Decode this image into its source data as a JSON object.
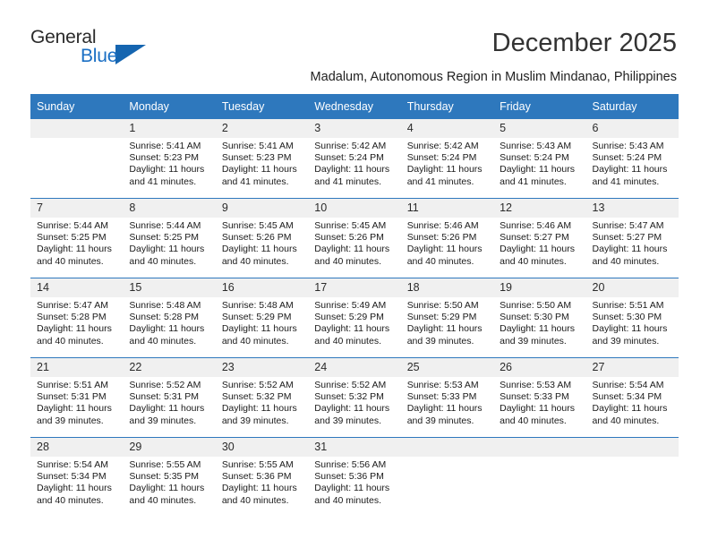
{
  "brand": {
    "name_primary": "General",
    "name_secondary": "Blue",
    "accent_color": "#1565b0",
    "header_color": "#2e78bd"
  },
  "header": {
    "month_title": "December 2025",
    "location": "Madalum, Autonomous Region in Muslim Mindanao, Philippines"
  },
  "weekdays": [
    "Sunday",
    "Monday",
    "Tuesday",
    "Wednesday",
    "Thursday",
    "Friday",
    "Saturday"
  ],
  "weeks": [
    [
      {
        "day": "",
        "empty": true,
        "sunrise": "",
        "sunset": "",
        "daylight_line1": "",
        "daylight_line2": ""
      },
      {
        "day": "1",
        "sunrise": "Sunrise: 5:41 AM",
        "sunset": "Sunset: 5:23 PM",
        "daylight_line1": "Daylight: 11 hours",
        "daylight_line2": "and 41 minutes."
      },
      {
        "day": "2",
        "sunrise": "Sunrise: 5:41 AM",
        "sunset": "Sunset: 5:23 PM",
        "daylight_line1": "Daylight: 11 hours",
        "daylight_line2": "and 41 minutes."
      },
      {
        "day": "3",
        "sunrise": "Sunrise: 5:42 AM",
        "sunset": "Sunset: 5:24 PM",
        "daylight_line1": "Daylight: 11 hours",
        "daylight_line2": "and 41 minutes."
      },
      {
        "day": "4",
        "sunrise": "Sunrise: 5:42 AM",
        "sunset": "Sunset: 5:24 PM",
        "daylight_line1": "Daylight: 11 hours",
        "daylight_line2": "and 41 minutes."
      },
      {
        "day": "5",
        "sunrise": "Sunrise: 5:43 AM",
        "sunset": "Sunset: 5:24 PM",
        "daylight_line1": "Daylight: 11 hours",
        "daylight_line2": "and 41 minutes."
      },
      {
        "day": "6",
        "sunrise": "Sunrise: 5:43 AM",
        "sunset": "Sunset: 5:24 PM",
        "daylight_line1": "Daylight: 11 hours",
        "daylight_line2": "and 41 minutes."
      }
    ],
    [
      {
        "day": "7",
        "sunrise": "Sunrise: 5:44 AM",
        "sunset": "Sunset: 5:25 PM",
        "daylight_line1": "Daylight: 11 hours",
        "daylight_line2": "and 40 minutes."
      },
      {
        "day": "8",
        "sunrise": "Sunrise: 5:44 AM",
        "sunset": "Sunset: 5:25 PM",
        "daylight_line1": "Daylight: 11 hours",
        "daylight_line2": "and 40 minutes."
      },
      {
        "day": "9",
        "sunrise": "Sunrise: 5:45 AM",
        "sunset": "Sunset: 5:26 PM",
        "daylight_line1": "Daylight: 11 hours",
        "daylight_line2": "and 40 minutes."
      },
      {
        "day": "10",
        "sunrise": "Sunrise: 5:45 AM",
        "sunset": "Sunset: 5:26 PM",
        "daylight_line1": "Daylight: 11 hours",
        "daylight_line2": "and 40 minutes."
      },
      {
        "day": "11",
        "sunrise": "Sunrise: 5:46 AM",
        "sunset": "Sunset: 5:26 PM",
        "daylight_line1": "Daylight: 11 hours",
        "daylight_line2": "and 40 minutes."
      },
      {
        "day": "12",
        "sunrise": "Sunrise: 5:46 AM",
        "sunset": "Sunset: 5:27 PM",
        "daylight_line1": "Daylight: 11 hours",
        "daylight_line2": "and 40 minutes."
      },
      {
        "day": "13",
        "sunrise": "Sunrise: 5:47 AM",
        "sunset": "Sunset: 5:27 PM",
        "daylight_line1": "Daylight: 11 hours",
        "daylight_line2": "and 40 minutes."
      }
    ],
    [
      {
        "day": "14",
        "sunrise": "Sunrise: 5:47 AM",
        "sunset": "Sunset: 5:28 PM",
        "daylight_line1": "Daylight: 11 hours",
        "daylight_line2": "and 40 minutes."
      },
      {
        "day": "15",
        "sunrise": "Sunrise: 5:48 AM",
        "sunset": "Sunset: 5:28 PM",
        "daylight_line1": "Daylight: 11 hours",
        "daylight_line2": "and 40 minutes."
      },
      {
        "day": "16",
        "sunrise": "Sunrise: 5:48 AM",
        "sunset": "Sunset: 5:29 PM",
        "daylight_line1": "Daylight: 11 hours",
        "daylight_line2": "and 40 minutes."
      },
      {
        "day": "17",
        "sunrise": "Sunrise: 5:49 AM",
        "sunset": "Sunset: 5:29 PM",
        "daylight_line1": "Daylight: 11 hours",
        "daylight_line2": "and 40 minutes."
      },
      {
        "day": "18",
        "sunrise": "Sunrise: 5:50 AM",
        "sunset": "Sunset: 5:29 PM",
        "daylight_line1": "Daylight: 11 hours",
        "daylight_line2": "and 39 minutes."
      },
      {
        "day": "19",
        "sunrise": "Sunrise: 5:50 AM",
        "sunset": "Sunset: 5:30 PM",
        "daylight_line1": "Daylight: 11 hours",
        "daylight_line2": "and 39 minutes."
      },
      {
        "day": "20",
        "sunrise": "Sunrise: 5:51 AM",
        "sunset": "Sunset: 5:30 PM",
        "daylight_line1": "Daylight: 11 hours",
        "daylight_line2": "and 39 minutes."
      }
    ],
    [
      {
        "day": "21",
        "sunrise": "Sunrise: 5:51 AM",
        "sunset": "Sunset: 5:31 PM",
        "daylight_line1": "Daylight: 11 hours",
        "daylight_line2": "and 39 minutes."
      },
      {
        "day": "22",
        "sunrise": "Sunrise: 5:52 AM",
        "sunset": "Sunset: 5:31 PM",
        "daylight_line1": "Daylight: 11 hours",
        "daylight_line2": "and 39 minutes."
      },
      {
        "day": "23",
        "sunrise": "Sunrise: 5:52 AM",
        "sunset": "Sunset: 5:32 PM",
        "daylight_line1": "Daylight: 11 hours",
        "daylight_line2": "and 39 minutes."
      },
      {
        "day": "24",
        "sunrise": "Sunrise: 5:52 AM",
        "sunset": "Sunset: 5:32 PM",
        "daylight_line1": "Daylight: 11 hours",
        "daylight_line2": "and 39 minutes."
      },
      {
        "day": "25",
        "sunrise": "Sunrise: 5:53 AM",
        "sunset": "Sunset: 5:33 PM",
        "daylight_line1": "Daylight: 11 hours",
        "daylight_line2": "and 39 minutes."
      },
      {
        "day": "26",
        "sunrise": "Sunrise: 5:53 AM",
        "sunset": "Sunset: 5:33 PM",
        "daylight_line1": "Daylight: 11 hours",
        "daylight_line2": "and 40 minutes."
      },
      {
        "day": "27",
        "sunrise": "Sunrise: 5:54 AM",
        "sunset": "Sunset: 5:34 PM",
        "daylight_line1": "Daylight: 11 hours",
        "daylight_line2": "and 40 minutes."
      }
    ],
    [
      {
        "day": "28",
        "sunrise": "Sunrise: 5:54 AM",
        "sunset": "Sunset: 5:34 PM",
        "daylight_line1": "Daylight: 11 hours",
        "daylight_line2": "and 40 minutes."
      },
      {
        "day": "29",
        "sunrise": "Sunrise: 5:55 AM",
        "sunset": "Sunset: 5:35 PM",
        "daylight_line1": "Daylight: 11 hours",
        "daylight_line2": "and 40 minutes."
      },
      {
        "day": "30",
        "sunrise": "Sunrise: 5:55 AM",
        "sunset": "Sunset: 5:36 PM",
        "daylight_line1": "Daylight: 11 hours",
        "daylight_line2": "and 40 minutes."
      },
      {
        "day": "31",
        "sunrise": "Sunrise: 5:56 AM",
        "sunset": "Sunset: 5:36 PM",
        "daylight_line1": "Daylight: 11 hours",
        "daylight_line2": "and 40 minutes."
      },
      {
        "day": "",
        "empty": true,
        "sunrise": "",
        "sunset": "",
        "daylight_line1": "",
        "daylight_line2": ""
      },
      {
        "day": "",
        "empty": true,
        "sunrise": "",
        "sunset": "",
        "daylight_line1": "",
        "daylight_line2": ""
      },
      {
        "day": "",
        "empty": true,
        "sunrise": "",
        "sunset": "",
        "daylight_line1": "",
        "daylight_line2": ""
      }
    ]
  ]
}
